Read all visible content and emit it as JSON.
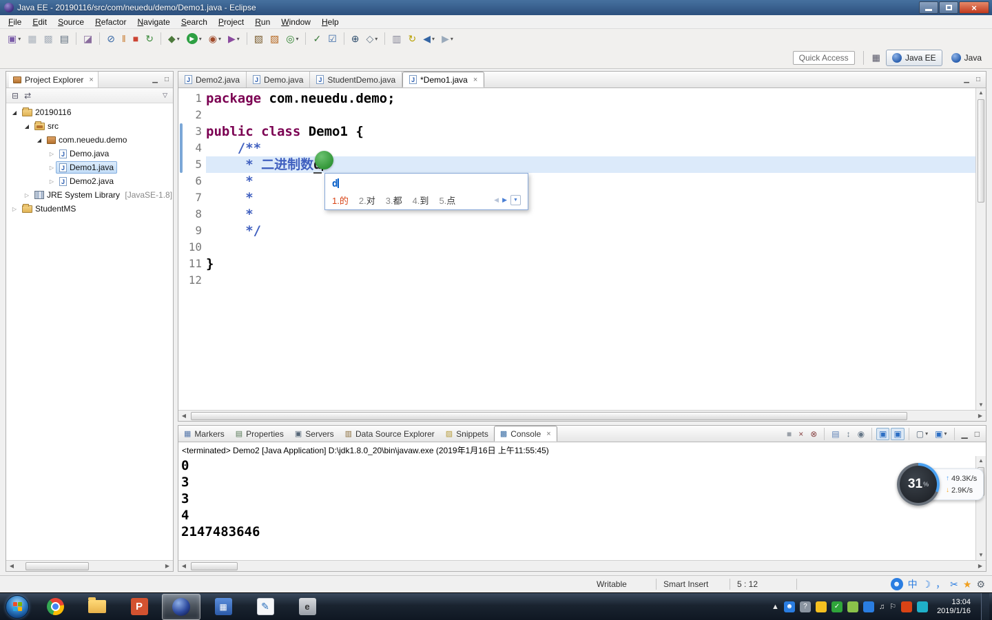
{
  "window": {
    "title": "Java EE - 20190116/src/com/neuedu/demo/Demo1.java - Eclipse"
  },
  "menu": [
    "File",
    "Edit",
    "Source",
    "Refactor",
    "Navigate",
    "Search",
    "Project",
    "Run",
    "Window",
    "Help"
  ],
  "toolbar": {
    "quick_access": "Quick Access",
    "icons": [
      {
        "name": "new-wizard-icon",
        "g": "▣",
        "c": "#7a5ca8",
        "dd": true
      },
      {
        "name": "save-icon",
        "g": "▦",
        "c": "#aab2bc"
      },
      {
        "name": "save-all-icon",
        "g": "▩",
        "c": "#aab2bc"
      },
      {
        "name": "print-icon",
        "g": "▤",
        "c": "#5a6a7a"
      },
      {
        "sep": true
      },
      {
        "name": "build-icon",
        "g": "◪",
        "c": "#8a6d9e"
      },
      {
        "sep": true
      },
      {
        "name": "skip-breakpoints-icon",
        "g": "⊘",
        "c": "#3465a4"
      },
      {
        "name": "suspend-icon",
        "g": "‖",
        "c": "#c87a2e"
      },
      {
        "name": "terminate-icon",
        "g": "■",
        "c": "#cc4433"
      },
      {
        "name": "relaunch-icon",
        "g": "↻",
        "c": "#3a8a3a"
      },
      {
        "sep": true
      },
      {
        "name": "debug-icon",
        "g": "◆",
        "c": "#4d7a3c",
        "dd": true
      },
      {
        "name": "run-icon",
        "g": "▶",
        "c": "#ffffff",
        "bg": "#2ea043",
        "dd": true
      },
      {
        "name": "coverage-icon",
        "g": "◉",
        "c": "#a04a2a",
        "dd": true
      },
      {
        "name": "run-external-icon",
        "g": "▶",
        "c": "#8a4a9e",
        "dd": true
      },
      {
        "sep": true
      },
      {
        "name": "new-java-project-icon",
        "g": "▧",
        "c": "#7a5c2e"
      },
      {
        "name": "new-package-icon",
        "g": "▨",
        "c": "#b5651d"
      },
      {
        "name": "new-class-icon",
        "g": "◎",
        "c": "#2a7f2a",
        "dd": true
      },
      {
        "sep": true
      },
      {
        "name": "junit-icon",
        "g": "✓",
        "c": "#3a7a3a"
      },
      {
        "name": "task-icon",
        "g": "☑",
        "c": "#3465a4"
      },
      {
        "sep": true
      },
      {
        "name": "search-icon",
        "g": "⊕",
        "c": "#2a4a6a"
      },
      {
        "name": "open-type-icon",
        "g": "◇",
        "c": "#667788",
        "dd": true
      },
      {
        "sep": true
      },
      {
        "name": "annotation-icon",
        "g": "▥",
        "c": "#888899"
      },
      {
        "name": "last-edit-icon",
        "g": "↻",
        "c": "#b8a000"
      },
      {
        "name": "back-icon",
        "g": "◀",
        "c": "#3465a4",
        "dd": true
      },
      {
        "name": "forward-icon",
        "g": "▶",
        "c": "#9aaabb",
        "dd": true
      }
    ],
    "perspectives": [
      {
        "label": "Java EE",
        "active": true
      },
      {
        "label": "Java",
        "active": false
      }
    ]
  },
  "explorer": {
    "title": "Project Explorer",
    "tree": [
      {
        "label": "20190116",
        "depth": 0,
        "icon": "project",
        "state": "expanded"
      },
      {
        "label": "src",
        "depth": 1,
        "icon": "src",
        "state": "expanded"
      },
      {
        "label": "com.neuedu.demo",
        "depth": 2,
        "icon": "package",
        "state": "expanded"
      },
      {
        "label": "Demo.java",
        "depth": 3,
        "icon": "java",
        "state": "collapsed"
      },
      {
        "label": "Demo1.java",
        "depth": 3,
        "icon": "java",
        "state": "collapsed",
        "selected": true
      },
      {
        "label": "Demo2.java",
        "depth": 3,
        "icon": "java",
        "state": "collapsed"
      },
      {
        "label": "JRE System Library",
        "suffix": "[JavaSE-1.8]",
        "depth": 1,
        "icon": "library",
        "state": "collapsed"
      },
      {
        "label": "StudentMS",
        "depth": 0,
        "icon": "folder",
        "state": "collapsed"
      }
    ]
  },
  "editor": {
    "tabs": [
      {
        "label": "Demo2.java",
        "active": false
      },
      {
        "label": "Demo.java",
        "active": false
      },
      {
        "label": "StudentDemo.java",
        "active": false
      },
      {
        "label": "*Demo1.java",
        "active": true
      }
    ],
    "lines": [
      {
        "num": "1",
        "segs": [
          {
            "c": "kw",
            "t": "package"
          },
          {
            "c": "pl",
            "t": " com.neuedu.demo;"
          }
        ]
      },
      {
        "num": "2",
        "segs": []
      },
      {
        "num": "3",
        "segs": [
          {
            "c": "kw",
            "t": "public class"
          },
          {
            "c": "pl",
            "t": " Demo1 {"
          }
        ]
      },
      {
        "num": "4",
        "segs": [
          {
            "c": "doc",
            "t": "    /**"
          }
        ]
      },
      {
        "num": "5",
        "current": true,
        "cursor": true,
        "segs": [
          {
            "c": "doc",
            "t": "     * 二进制数"
          },
          {
            "c": "ime",
            "t": "d"
          }
        ]
      },
      {
        "num": "6",
        "segs": [
          {
            "c": "doc",
            "t": "     *"
          }
        ]
      },
      {
        "num": "7",
        "segs": [
          {
            "c": "doc",
            "t": "     *"
          }
        ]
      },
      {
        "num": "8",
        "segs": [
          {
            "c": "doc",
            "t": "     *"
          }
        ]
      },
      {
        "num": "9",
        "segs": [
          {
            "c": "doc",
            "t": "     */"
          }
        ]
      },
      {
        "num": "10",
        "segs": []
      },
      {
        "num": "11",
        "segs": [
          {
            "c": "pl",
            "t": "}"
          }
        ]
      },
      {
        "num": "12",
        "segs": []
      }
    ],
    "ime": {
      "composition": "d",
      "candidates": [
        {
          "n": "1.",
          "t": "的"
        },
        {
          "n": "2.",
          "t": "对"
        },
        {
          "n": "3.",
          "t": "都"
        },
        {
          "n": "4.",
          "t": "到"
        },
        {
          "n": "5.",
          "t": "点"
        }
      ]
    }
  },
  "console": {
    "tabs": [
      {
        "label": "Markers",
        "icon": "markers",
        "g": "▦",
        "c": "#5577aa"
      },
      {
        "label": "Properties",
        "icon": "properties",
        "g": "▤",
        "c": "#557755"
      },
      {
        "label": "Servers",
        "icon": "servers",
        "g": "▣",
        "c": "#556677"
      },
      {
        "label": "Data Source Explorer",
        "icon": "data-source",
        "g": "▥",
        "c": "#8a6d3b"
      },
      {
        "label": "Snippets",
        "icon": "snippets",
        "g": "▨",
        "c": "#b59a3a"
      },
      {
        "label": "Console",
        "icon": "console",
        "g": "▩",
        "c": "#3a6ea5",
        "active": true
      }
    ],
    "toolbar_icons": [
      {
        "name": "terminate-console-icon",
        "g": "■",
        "c": "#9aa0a8"
      },
      {
        "name": "remove-launch-icon",
        "g": "×",
        "c": "#884444"
      },
      {
        "name": "remove-all-launches-icon",
        "g": "⊗",
        "c": "#884444"
      },
      {
        "sep": true
      },
      {
        "name": "clear-console-icon",
        "g": "▤",
        "c": "#5a7fb5"
      },
      {
        "name": "scroll-lock-icon",
        "g": "↕",
        "c": "#667788"
      },
      {
        "name": "pin-console-icon",
        "g": "◉",
        "c": "#667788"
      },
      {
        "sep": true
      },
      {
        "name": "show-on-stdout-icon",
        "g": "▣",
        "c": "#2d6fc4",
        "pressed": true
      },
      {
        "name": "show-on-stderr-icon",
        "g": "▣",
        "c": "#2d6fc4",
        "pressed": true
      },
      {
        "sep": true
      },
      {
        "name": "display-console-icon",
        "g": "▢",
        "c": "#556677",
        "dd": true
      },
      {
        "name": "open-console-icon",
        "g": "▣",
        "c": "#2d6fc4",
        "dd": true
      },
      {
        "sep": true
      },
      {
        "name": "minimize-view-icon",
        "g": "▁",
        "c": "#555555"
      },
      {
        "name": "maximize-view-icon",
        "g": "□",
        "c": "#555555"
      }
    ],
    "terminated": "<terminated> Demo2 [Java Application] D:\\jdk1.8.0_20\\bin\\javaw.exe (2019年1月16日 上午11:55:45)",
    "output": [
      "0",
      "3",
      "3",
      "4",
      "2147483646"
    ]
  },
  "status": {
    "writable": "Writable",
    "mode": "Smart Insert",
    "position": "5 : 12",
    "ime_icons": [
      {
        "name": "sogou-account-icon",
        "g": "☻",
        "c": "#ffffff",
        "bg": "#2a7de1"
      },
      {
        "name": "chinese-mode-icon",
        "g": "中",
        "c": "#2a7de1"
      },
      {
        "name": "fullwidth-moon-icon",
        "g": "☽",
        "c": "#2a7de1"
      },
      {
        "name": "punctuation-icon",
        "g": "，",
        "c": "#2a7de1"
      },
      {
        "name": "scissors-icon",
        "g": "✂",
        "c": "#2a7de1"
      },
      {
        "name": "medal-icon",
        "g": "★",
        "c": "#f0a020"
      },
      {
        "name": "settings-gear-icon",
        "g": "⚙",
        "c": "#5a6570"
      }
    ]
  },
  "net": {
    "percent": "31",
    "unit": "%",
    "up": "49.3K/s",
    "down": "2.9K/s"
  },
  "taskbar": {
    "buttons": [
      {
        "name": "chrome"
      },
      {
        "name": "explorer"
      },
      {
        "name": "powerpoint",
        "glyph": "P"
      },
      {
        "name": "eclipse",
        "active": true
      },
      {
        "name": "calculator",
        "glyph": "▦"
      },
      {
        "name": "notes",
        "glyph": "✎"
      },
      {
        "name": "editor",
        "glyph": "e"
      }
    ],
    "tray": [
      {
        "name": "tray-expand-icon",
        "g": "▲",
        "c": "#e8e8e8"
      },
      {
        "name": "im-user-icon",
        "g": "☻",
        "c": "#ffffff",
        "bg": "#2a7de1"
      },
      {
        "name": "help-icon",
        "g": "?",
        "c": "#ffffff",
        "bg": "#8a94a0"
      },
      {
        "name": "download-icon",
        "g": "",
        "bg": "#f5c020"
      },
      {
        "name": "security-check-icon",
        "g": "✓",
        "c": "#ffffff",
        "bg": "#2fa53a"
      },
      {
        "name": "accelerate-ball-icon",
        "g": "",
        "bg": "#8ac24a"
      },
      {
        "name": "shield-icon",
        "g": "",
        "bg": "#2a7de1"
      },
      {
        "name": "audio-icon",
        "g": "♫",
        "c": "#e8e8e8"
      },
      {
        "name": "network-flag-icon",
        "g": "⚐",
        "c": "#e8e8e8"
      },
      {
        "name": "update-icon",
        "g": "",
        "bg": "#d84315"
      },
      {
        "name": "message-icon",
        "g": "",
        "bg": "#1fb0c8"
      }
    ],
    "time": "13:04",
    "date": "2019/1/16"
  }
}
